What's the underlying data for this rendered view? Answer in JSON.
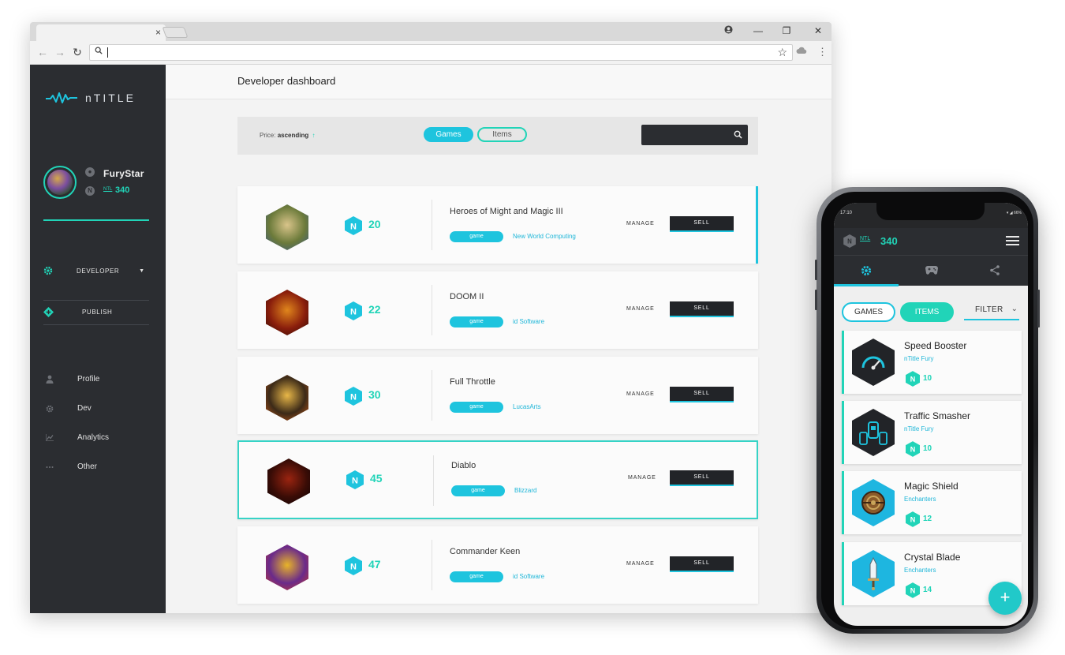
{
  "browser": {
    "tab_close": "×",
    "controls": {
      "account": "⊖",
      "minimize": "—",
      "restore": "❐",
      "close": "✕"
    },
    "nav": {
      "back": "←",
      "forward": "→",
      "reload": "↻"
    },
    "star": "☆",
    "menu": "⋮"
  },
  "sidebar": {
    "logo_text": "nTITLE",
    "user": {
      "name": "FuryStar",
      "ntl_label": "NTL",
      "balance": "340"
    },
    "developer_label": "DEVELOPER",
    "publish_label": "PUBLISH",
    "links": [
      {
        "label": "Profile",
        "icon": "person-icon"
      },
      {
        "label": "Dev",
        "icon": "gear-icon"
      },
      {
        "label": "Analytics",
        "icon": "chart-icon"
      },
      {
        "label": "Other",
        "icon": "dots-icon"
      }
    ]
  },
  "main": {
    "title": "Developer dashboard",
    "sort": {
      "prefix": "Price:",
      "value": "ascending",
      "arrow": "↑"
    },
    "pills": {
      "games": "Games",
      "items": "Items"
    },
    "manage_label": "MANAGE",
    "sell_label": "SELL",
    "games": [
      {
        "title": "Heroes of Might and Magic III",
        "price": "20",
        "tag": "game",
        "developer": "New World Computing",
        "logo_colors": [
          "#d9c48a",
          "#6b7a3a",
          "#3a5a86"
        ]
      },
      {
        "title": "DOOM II",
        "price": "22",
        "tag": "game",
        "developer": "id Software",
        "logo_colors": [
          "#e0861c",
          "#8a1e0c",
          "#2a0a05"
        ]
      },
      {
        "title": "Full Throttle",
        "price": "30",
        "tag": "game",
        "developer": "LucasArts",
        "logo_colors": [
          "#e8b748",
          "#3c2a18",
          "#c45a1a"
        ]
      },
      {
        "title": "Diablo",
        "price": "45",
        "tag": "game",
        "developer": "Blizzard",
        "logo_colors": [
          "#9a2410",
          "#3a0c06",
          "#0c0404"
        ]
      },
      {
        "title": "Commander Keen",
        "price": "47",
        "tag": "game",
        "developer": "id Software",
        "logo_colors": [
          "#e8b428",
          "#6a2a8a",
          "#c83a2a"
        ]
      }
    ]
  },
  "phone": {
    "status_time": "17:10",
    "status_right": "▾ ◢ 66%",
    "ntl_label": "NTL",
    "balance": "340",
    "pills": {
      "games": "GAMES",
      "items": "ITEMS",
      "filter": "FILTER"
    },
    "items": [
      {
        "name": "Speed Booster",
        "publisher": "nTitle Fury",
        "price": "10",
        "icon": "speedometer-icon"
      },
      {
        "name": "Traffic Smasher",
        "publisher": "nTitle Fury",
        "price": "10",
        "icon": "cars-icon"
      },
      {
        "name": "Magic Shield",
        "publisher": "Enchanters",
        "price": "12",
        "icon": "shield-icon"
      },
      {
        "name": "Crystal Blade",
        "publisher": "Enchanters",
        "price": "14",
        "icon": "sword-icon"
      }
    ],
    "fab": "+"
  },
  "colors": {
    "accent_teal": "#21d4b8",
    "accent_cyan": "#1ec4de",
    "sidebar_bg": "#2b2d31"
  }
}
